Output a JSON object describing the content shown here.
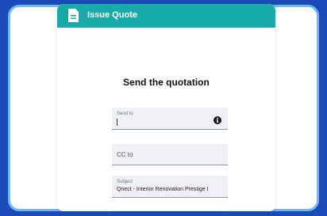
{
  "header": {
    "icon": "document-icon",
    "title": "Issue Quote"
  },
  "form": {
    "title": "Send the quotation",
    "send_to": {
      "label": "Send to",
      "value": "",
      "icon": "info-icon"
    },
    "cc": {
      "placeholder": "CC to"
    },
    "subject": {
      "label": "Subject",
      "value": "Qnect - Interior Renovation Prestige I"
    }
  },
  "colors": {
    "background": "#1a4bb8",
    "header": "#18aaa6",
    "frame_border": "#6fb6f2",
    "field_bg": "#eef0f4"
  }
}
